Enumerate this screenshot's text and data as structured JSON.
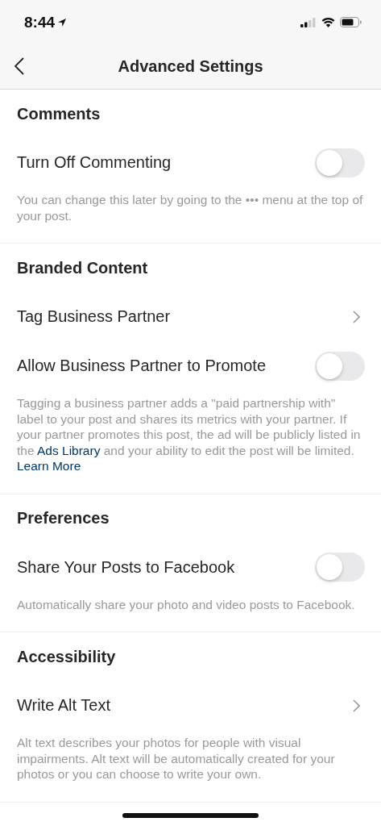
{
  "status_bar": {
    "time": "8:44"
  },
  "nav": {
    "title": "Advanced Settings"
  },
  "sections": [
    {
      "title": "Comments",
      "rows": [
        {
          "kind": "toggle",
          "label": "Turn Off Commenting",
          "on": false
        }
      ],
      "note": [
        {
          "kind": "plain",
          "text": "You can change this later by going to the ••• menu at the top of your post."
        }
      ]
    },
    {
      "title": "Branded Content",
      "rows": [
        {
          "kind": "link",
          "label": "Tag Business Partner"
        },
        {
          "kind": "toggle",
          "label": "Allow Business Partner to Promote",
          "on": false
        }
      ],
      "note": [
        {
          "kind": "plain",
          "text": "Tagging a business partner adds a \"paid partnership with\" label to your post and shares its metrics with your partner. If your partner promotes this post, the ad will be publicly listed in the "
        },
        {
          "kind": "link",
          "text": "Ads Library"
        },
        {
          "kind": "plain",
          "text": " and your ability to edit the post will be limited. "
        },
        {
          "kind": "link",
          "text": "Learn More"
        }
      ]
    },
    {
      "title": "Preferences",
      "rows": [
        {
          "kind": "toggle",
          "label": "Share Your Posts to Facebook",
          "on": false
        }
      ],
      "note": [
        {
          "kind": "plain",
          "text": "Automatically share your photo and video posts to Facebook."
        }
      ]
    },
    {
      "title": "Accessibility",
      "rows": [
        {
          "kind": "link",
          "label": "Write Alt Text"
        }
      ],
      "note": [
        {
          "kind": "plain",
          "text": "Alt text describes your photos for people with visual impairments. Alt text will be automatically created for your photos or you can choose to write your own."
        }
      ]
    }
  ]
}
